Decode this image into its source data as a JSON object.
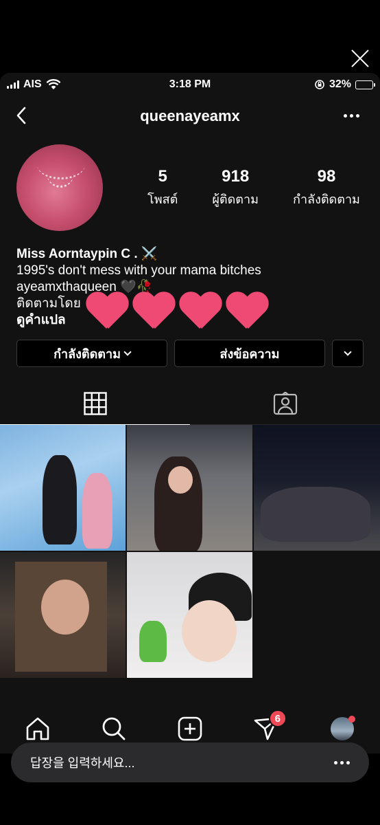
{
  "status": {
    "carrier": "AIS",
    "time": "3:18 PM",
    "battery": "32%",
    "battery_level": 0.32
  },
  "header": {
    "username": "queenayeamx"
  },
  "profile": {
    "stats": [
      {
        "value": "5",
        "label": "โพสต์"
      },
      {
        "value": "918",
        "label": "ผู้ติดตาม"
      },
      {
        "value": "98",
        "label": "กำลังติดตาม"
      }
    ],
    "name": "Miss Aorntaypin C . ⚔️",
    "bio_line": "1995's don't mess with your mama bitches",
    "handle_line": "ayeamxthaqueen 🖤🥀",
    "followed_by": "ติดตามโดย",
    "translate": "ดูคำแปล"
  },
  "actions": {
    "following_label": "กำลังติดตาม",
    "message_label": "ส่งข้อความ"
  },
  "tabbar": {
    "activity_badge": "6"
  },
  "reply": {
    "placeholder": "답장을 입력하세요..."
  },
  "colors": {
    "accent_red": "#ed4956",
    "sticker_pink": "#ee4a73",
    "battery_green": "#4cd964"
  }
}
